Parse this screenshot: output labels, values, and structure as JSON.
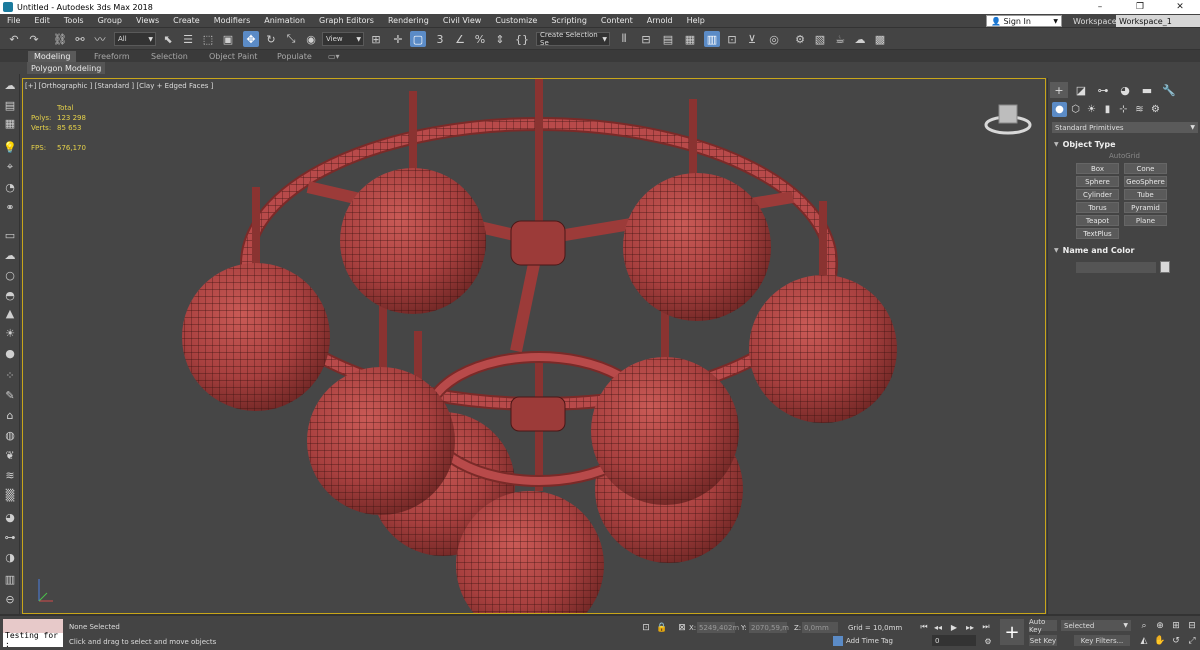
{
  "window": {
    "title": "Untitled - Autodesk 3ds Max 2018",
    "controls": [
      "–",
      "❐",
      "✕"
    ]
  },
  "menubar": {
    "items": [
      "File",
      "Edit",
      "Tools",
      "Group",
      "Views",
      "Create",
      "Modifiers",
      "Animation",
      "Graph Editors",
      "Rendering",
      "Civil View",
      "Customize",
      "Scripting",
      "Content",
      "Arnold",
      "Help"
    ],
    "sign_in": "Sign In",
    "workspaces_label": "Workspaces:",
    "workspace_value": "Workspace_1"
  },
  "toolbar": {
    "filter_value": "All",
    "refcoord_value": "View",
    "selection_set_value": "Create Selection Se"
  },
  "ribbon": {
    "tabs": [
      "Modeling",
      "Freeform",
      "Selection",
      "Object Paint",
      "Populate"
    ],
    "active_tab": "Modeling",
    "sub_label": "Polygon Modeling"
  },
  "viewport": {
    "label": "[+] [Orthographic ] [Standard ] [Clay + Edged Faces ]",
    "stats": {
      "total_label": "Total",
      "polys_label": "Polys:",
      "polys_value": "123 298",
      "verts_label": "Verts:",
      "verts_value": "85 653",
      "fps_label": "FPS:",
      "fps_value": "576,170"
    },
    "model_color": "#b84a4a",
    "background_color": "#464646",
    "border_color": "#c8a61a"
  },
  "command_panel": {
    "category_dropdown": "Standard Primitives",
    "object_type_title": "Object Type",
    "autogrid_label": "AutoGrid",
    "object_buttons": [
      "Box",
      "Cone",
      "Sphere",
      "GeoSphere",
      "Cylinder",
      "Tube",
      "Torus",
      "Pyramid",
      "Teapot",
      "Plane",
      "TextPlus"
    ],
    "name_color_title": "Name and Color"
  },
  "statusbar": {
    "script_input": "Testing for :",
    "selection_status": "None Selected",
    "prompt": "Click and drag to select and move objects",
    "x_label": "X:",
    "x_value": "5249,402m",
    "y_label": "Y:",
    "y_value": "2070,59,m",
    "z_label": "Z:",
    "z_value": "0,0mm",
    "grid": "Grid = 10,0mm",
    "add_time_tag": "Add Time Tag",
    "frame_value": "0",
    "auto_key": "Auto Key",
    "set_key": "Set Key",
    "selected_dropdown": "Selected",
    "key_filters": "Key Filters..."
  }
}
